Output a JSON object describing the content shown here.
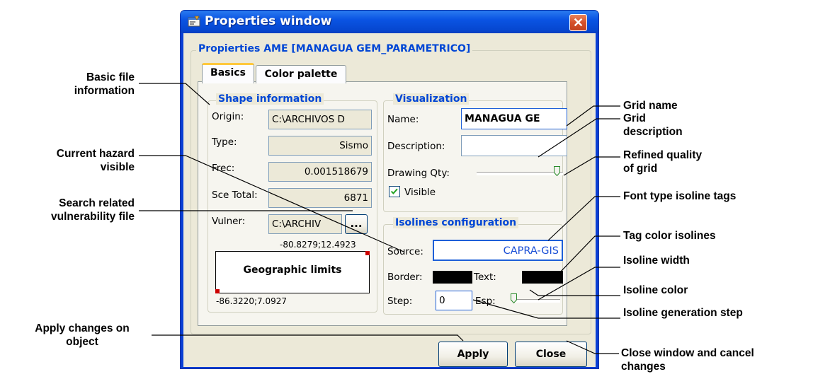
{
  "window": {
    "title": "Properties window",
    "close_glyph": "✕",
    "group_title": "Propierties AME [MANAGUA GEM_PARAMETRICO]"
  },
  "tabs": [
    {
      "label": "Basics",
      "active": true
    },
    {
      "label": "Color palette",
      "active": false
    }
  ],
  "shape_info": {
    "legend": "Shape information",
    "origin_label": "Origin:",
    "origin_value": "C:\\ARCHIVOS D",
    "type_label": "Type:",
    "type_value": "Sismo",
    "frec_label": "Frec:",
    "frec_value": "0.001518679",
    "sce_label": "Sce Total:",
    "sce_value": "6871",
    "vulner_label": "Vulner:",
    "vulner_value": "C:\\ARCHIV",
    "browse_label": "...",
    "coord_top": "-80.8279;12.4923",
    "geo_label": "Geographic limits",
    "coord_bottom": "-86.3220;7.0927"
  },
  "visualization": {
    "legend": "Visualization",
    "name_label": "Name:",
    "name_value": "MANAGUA GE",
    "desc_label": "Description:",
    "desc_value": "",
    "qty_label": "Drawing Qty:",
    "qty_level": 1.0,
    "visible_label": "Visible",
    "visible_checked": true
  },
  "isolines": {
    "legend": "Isolines configuration",
    "source_label": "Source:",
    "source_value": "CAPRA-GIS",
    "border_label": "Border:",
    "border_color": "#000000",
    "text_label": "Text:",
    "text_color": "#000000",
    "step_label": "Step:",
    "step_value": "0",
    "esp_label": "Esp:",
    "esp_level": 0.0
  },
  "buttons": {
    "apply": "Apply",
    "close": "Close"
  },
  "callouts": {
    "basic_file": "Basic file\ninformation",
    "hazard_visible": "Current hazard\nvisible",
    "search_vuln": "Search related\nvulnerability file",
    "apply_changes": "Apply changes on\nobject",
    "grid_name": "Grid name",
    "grid_desc": "Grid\ndescription",
    "refined": "Refined quality\nof grid",
    "font_type": "Font type isoline tags",
    "tag_color": "Tag color isolines",
    "iso_width": "Isoline width",
    "iso_color": "Isoline color",
    "iso_step": "Isoline generation step",
    "close_window": "Close window and cancel\nchanges"
  },
  "colors": {
    "title_blue": "#0a54e3",
    "legend_blue": "#0046d5",
    "face": "#ece9d8"
  }
}
